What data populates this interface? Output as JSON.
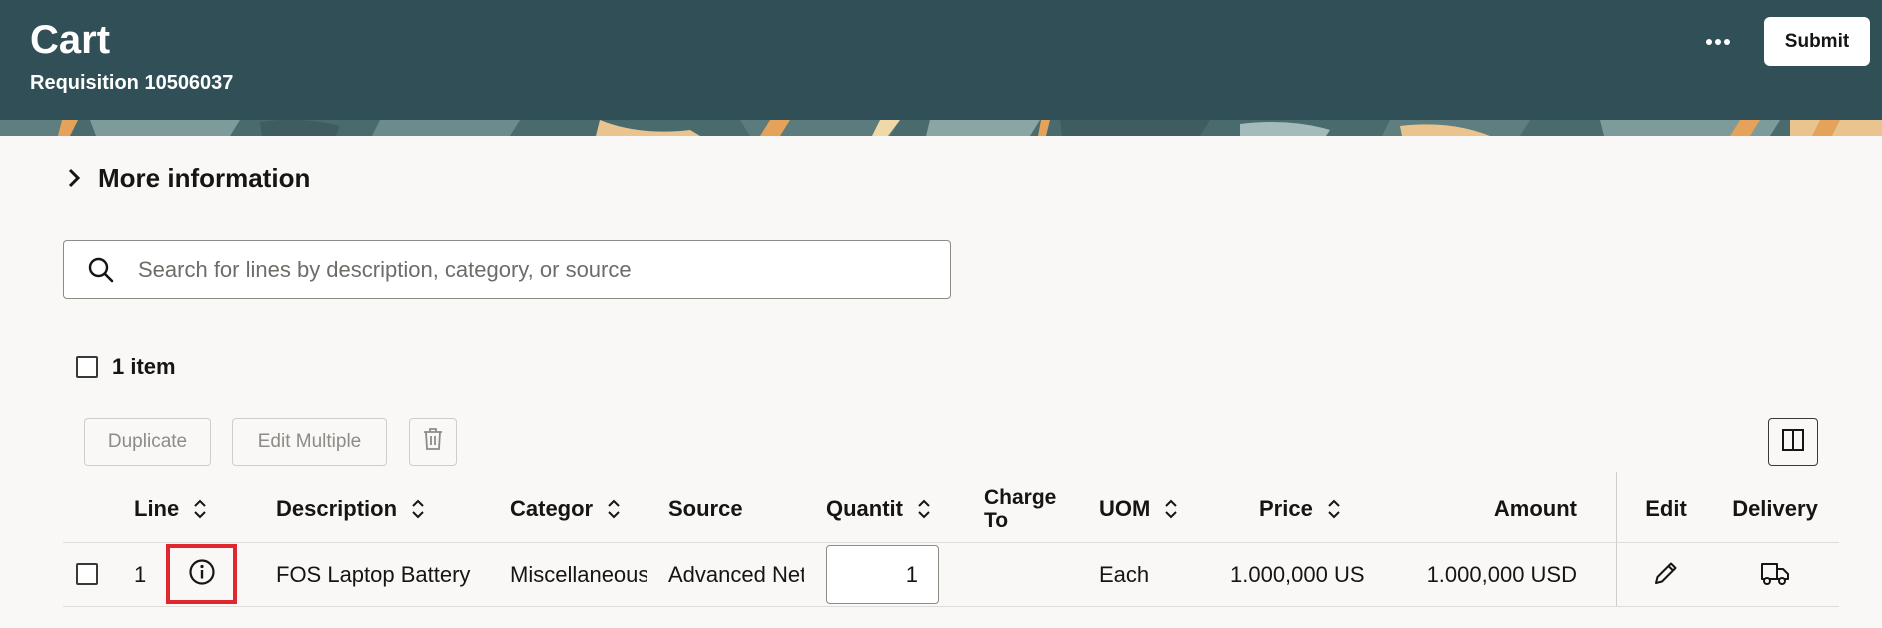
{
  "header": {
    "title": "Cart",
    "subtitle": "Requisition 10506037",
    "more_icon": "more-horizontal-icon",
    "submit_label": "Submit",
    "background_color": "#314f56"
  },
  "more_information": {
    "label": "More information",
    "icon": "chevron-right-icon"
  },
  "search": {
    "placeholder": "Search for lines by description, category, or source",
    "value": "",
    "icon": "search-icon"
  },
  "selection": {
    "count_label": "1 item"
  },
  "toolbar": {
    "duplicate_label": "Duplicate",
    "edit_multiple_label": "Edit Multiple",
    "delete_icon": "trash-icon",
    "columns_icon": "panel-columns-icon"
  },
  "table": {
    "columns": {
      "line": "Line",
      "description": "Description",
      "category": "Categor",
      "source": "Source",
      "quantity": "Quantit",
      "charge_to": "Charge\nTo",
      "uom": "UOM",
      "price": "Price",
      "amount": "Amount",
      "edit": "Edit",
      "delivery": "Delivery"
    },
    "rows": [
      {
        "line": "1",
        "info_icon": "info-icon",
        "description": "FOS Laptop Battery",
        "category": "Miscellaneous",
        "source": "Advanced Net",
        "quantity": "1",
        "charge_to": "",
        "uom": "Each",
        "price": "1.000,000 US",
        "amount": "1.000,000 USD",
        "edit_icon": "pencil-icon",
        "delivery_icon": "truck-icon"
      }
    ]
  },
  "colors": {
    "highlight": "#e0262f",
    "header_bg": "#314f56",
    "page_bg": "#f9f8f6"
  }
}
